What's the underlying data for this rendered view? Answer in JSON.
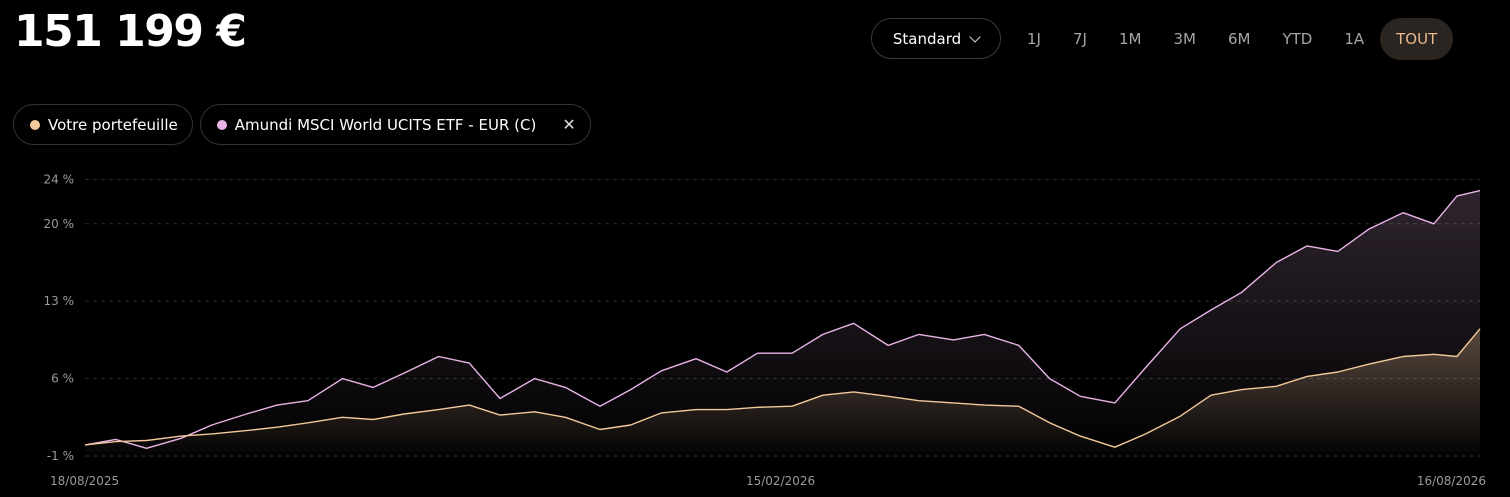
{
  "header": {
    "total_value": "151 199 €",
    "mode_label": "Standard",
    "ranges": [
      "1J",
      "7J",
      "1M",
      "3M",
      "6M",
      "YTD",
      "1A",
      "TOUT"
    ],
    "active_range": "TOUT"
  },
  "legend": [
    {
      "label": "Votre portefeuille",
      "color": "#f2c99a"
    },
    {
      "label": "Amundi MSCI World UCITS ETF - EUR (C)",
      "color": "#e8b4e6",
      "removable": true
    }
  ],
  "chart_data": {
    "type": "area",
    "x_start": "18/08/2025",
    "x_end": "16/08/2026",
    "x_tick_labels": [
      "18/08/2025",
      "15/02/2026",
      "16/08/2026"
    ],
    "y_tick_labels": [
      "24 %",
      "20 %",
      "13 %",
      "6 %",
      "-1 %"
    ],
    "y_ticks": [
      24,
      20,
      13,
      6,
      -1
    ],
    "ylim": [
      -1,
      24.5
    ],
    "grid": true,
    "series": [
      {
        "name": "Votre portefeuille",
        "color": "#f2c99a",
        "points": [
          [
            "18/08/2025",
            0.0
          ],
          [
            "26/08/2025",
            0.3
          ],
          [
            "03/09/2025",
            0.4
          ],
          [
            "12/09/2025",
            0.8
          ],
          [
            "20/09/2025",
            1.0
          ],
          [
            "29/09/2025",
            1.3
          ],
          [
            "07/10/2025",
            1.6
          ],
          [
            "15/10/2025",
            2.0
          ],
          [
            "24/10/2025",
            2.5
          ],
          [
            "01/11/2025",
            2.3
          ],
          [
            "09/11/2025",
            2.8
          ],
          [
            "18/11/2025",
            3.2
          ],
          [
            "26/11/2025",
            3.6
          ],
          [
            "04/12/2025",
            2.7
          ],
          [
            "13/12/2025",
            3.0
          ],
          [
            "21/12/2025",
            2.5
          ],
          [
            "30/12/2025",
            1.4
          ],
          [
            "07/01/2026",
            1.8
          ],
          [
            "15/01/2026",
            2.9
          ],
          [
            "24/01/2026",
            3.2
          ],
          [
            "01/02/2026",
            3.2
          ],
          [
            "09/02/2026",
            3.4
          ],
          [
            "18/02/2026",
            3.5
          ],
          [
            "26/02/2026",
            4.5
          ],
          [
            "06/03/2026",
            4.8
          ],
          [
            "15/03/2026",
            4.4
          ],
          [
            "23/03/2026",
            4.0
          ],
          [
            "01/04/2026",
            3.8
          ],
          [
            "09/04/2026",
            3.6
          ],
          [
            "18/04/2026",
            3.5
          ],
          [
            "26/04/2026",
            2.0
          ],
          [
            "04/05/2026",
            0.8
          ],
          [
            "13/05/2026",
            -0.2
          ],
          [
            "21/05/2026",
            1.0
          ],
          [
            "30/05/2026",
            2.6
          ],
          [
            "07/06/2026",
            4.5
          ],
          [
            "15/06/2026",
            5.0
          ],
          [
            "24/06/2026",
            5.3
          ],
          [
            "02/07/2026",
            6.2
          ],
          [
            "10/07/2026",
            6.6
          ],
          [
            "18/07/2026",
            7.3
          ],
          [
            "27/07/2026",
            8.0
          ],
          [
            "04/08/2026",
            8.2
          ],
          [
            "10/08/2026",
            8.0
          ],
          [
            "16/08/2026",
            10.5
          ]
        ]
      },
      {
        "name": "Amundi MSCI World UCITS ETF - EUR (C)",
        "color": "#e8b4e6",
        "points": [
          [
            "18/08/2025",
            0.0
          ],
          [
            "26/08/2025",
            0.5
          ],
          [
            "03/09/2025",
            -0.3
          ],
          [
            "12/09/2025",
            0.6
          ],
          [
            "20/09/2025",
            1.8
          ],
          [
            "29/09/2025",
            2.8
          ],
          [
            "07/10/2025",
            3.6
          ],
          [
            "15/10/2025",
            4.0
          ],
          [
            "24/10/2025",
            6.0
          ],
          [
            "01/11/2025",
            5.2
          ],
          [
            "09/11/2025",
            6.5
          ],
          [
            "18/11/2025",
            8.0
          ],
          [
            "26/11/2025",
            7.4
          ],
          [
            "04/12/2025",
            4.2
          ],
          [
            "13/12/2025",
            6.0
          ],
          [
            "21/12/2025",
            5.2
          ],
          [
            "30/12/2025",
            3.5
          ],
          [
            "07/01/2026",
            5.0
          ],
          [
            "15/01/2026",
            6.7
          ],
          [
            "24/01/2026",
            7.8
          ],
          [
            "01/02/2026",
            6.6
          ],
          [
            "09/02/2026",
            8.3
          ],
          [
            "18/02/2026",
            8.3
          ],
          [
            "26/02/2026",
            10.0
          ],
          [
            "06/03/2026",
            11.0
          ],
          [
            "15/03/2026",
            9.0
          ],
          [
            "23/03/2026",
            10.0
          ],
          [
            "01/04/2026",
            9.5
          ],
          [
            "09/04/2026",
            10.0
          ],
          [
            "18/04/2026",
            9.0
          ],
          [
            "26/04/2026",
            6.0
          ],
          [
            "04/05/2026",
            4.4
          ],
          [
            "13/05/2026",
            3.8
          ],
          [
            "21/05/2026",
            7.0
          ],
          [
            "30/05/2026",
            10.5
          ],
          [
            "07/06/2026",
            12.2
          ],
          [
            "15/06/2026",
            13.8
          ],
          [
            "24/06/2026",
            16.5
          ],
          [
            "02/07/2026",
            18.0
          ],
          [
            "10/07/2026",
            17.5
          ],
          [
            "18/07/2026",
            19.5
          ],
          [
            "27/07/2026",
            21.0
          ],
          [
            "04/08/2026",
            20.0
          ],
          [
            "10/08/2026",
            22.5
          ],
          [
            "16/08/2026",
            23.0
          ]
        ]
      }
    ]
  }
}
